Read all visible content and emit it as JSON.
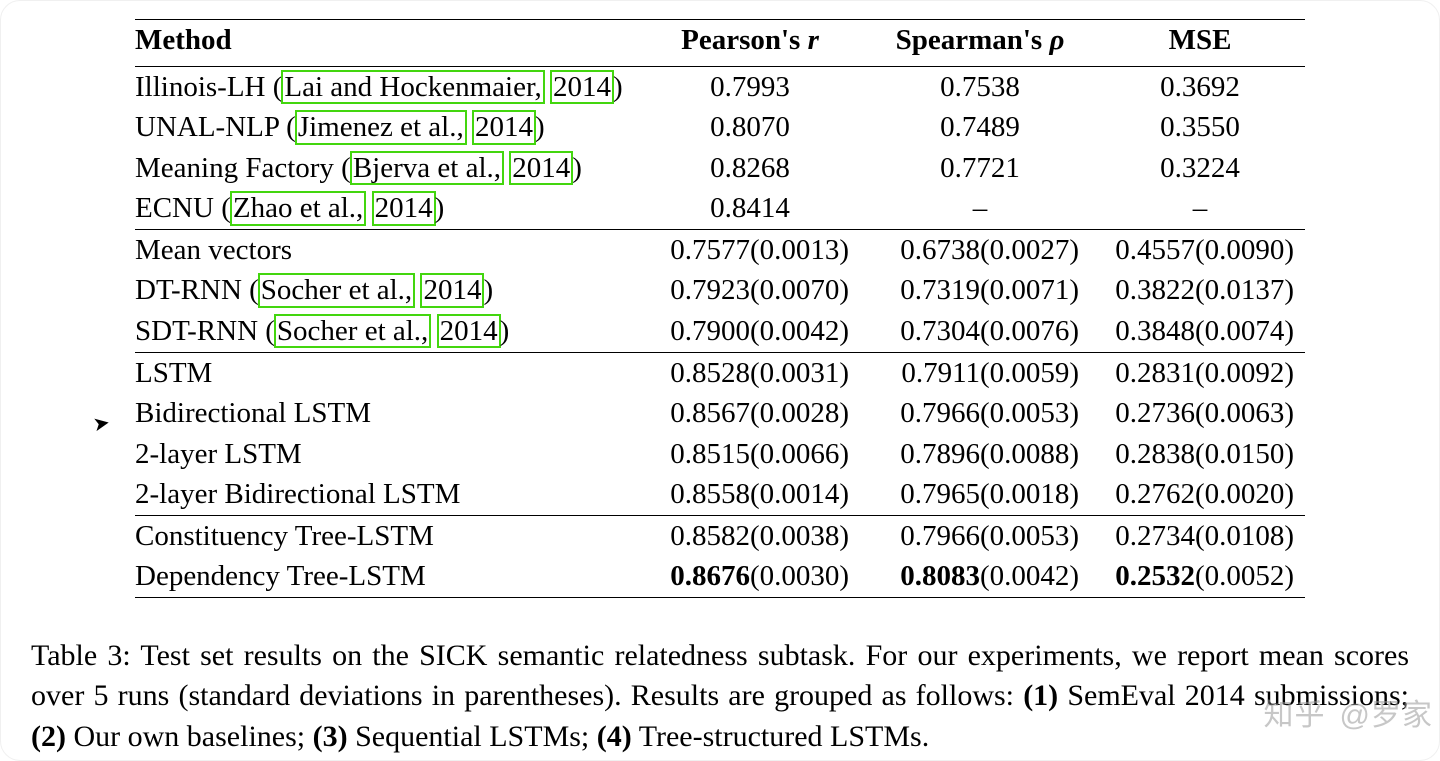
{
  "chart_data": {
    "type": "table",
    "title": "Table 3: Test set results on the SICK semantic relatedness subtask",
    "columns": [
      "Method",
      "Pearson's r",
      "Pearson's r (std)",
      "Spearman's ρ",
      "Spearman's ρ (std)",
      "MSE",
      "MSE (std)"
    ],
    "groups": [
      {
        "name": "SemEval 2014 submissions",
        "rows": [
          {
            "method": "Illinois-LH (Lai and Hockenmaier, 2014)",
            "pearson": 0.7993,
            "spearman": 0.7538,
            "mse": 0.3692
          },
          {
            "method": "UNAL-NLP (Jimenez et al., 2014)",
            "pearson": 0.807,
            "spearman": 0.7489,
            "mse": 0.355
          },
          {
            "method": "Meaning Factory (Bjerva et al., 2014)",
            "pearson": 0.8268,
            "spearman": 0.7721,
            "mse": 0.3224
          },
          {
            "method": "ECNU (Zhao et al., 2014)",
            "pearson": 0.8414,
            "spearman": null,
            "mse": null
          }
        ]
      },
      {
        "name": "Our own baselines",
        "rows": [
          {
            "method": "Mean vectors",
            "pearson": 0.7577,
            "pearson_std": 0.0013,
            "spearman": 0.6738,
            "spearman_std": 0.0027,
            "mse": 0.4557,
            "mse_std": 0.009
          },
          {
            "method": "DT-RNN (Socher et al., 2014)",
            "pearson": 0.7923,
            "pearson_std": 0.007,
            "spearman": 0.7319,
            "spearman_std": 0.0071,
            "mse": 0.3822,
            "mse_std": 0.0137
          },
          {
            "method": "SDT-RNN (Socher et al., 2014)",
            "pearson": 0.79,
            "pearson_std": 0.0042,
            "spearman": 0.7304,
            "spearman_std": 0.0076,
            "mse": 0.3848,
            "mse_std": 0.0074
          }
        ]
      },
      {
        "name": "Sequential LSTMs",
        "rows": [
          {
            "method": "LSTM",
            "pearson": 0.8528,
            "pearson_std": 0.0031,
            "spearman": 0.7911,
            "spearman_std": 0.0059,
            "mse": 0.2831,
            "mse_std": 0.0092
          },
          {
            "method": "Bidirectional LSTM",
            "pearson": 0.8567,
            "pearson_std": 0.0028,
            "spearman": 0.7966,
            "spearman_std": 0.0053,
            "mse": 0.2736,
            "mse_std": 0.0063
          },
          {
            "method": "2-layer LSTM",
            "pearson": 0.8515,
            "pearson_std": 0.0066,
            "spearman": 0.7896,
            "spearman_std": 0.0088,
            "mse": 0.2838,
            "mse_std": 0.015
          },
          {
            "method": "2-layer Bidirectional LSTM",
            "pearson": 0.8558,
            "pearson_std": 0.0014,
            "spearman": 0.7965,
            "spearman_std": 0.0018,
            "mse": 0.2762,
            "mse_std": 0.002
          }
        ]
      },
      {
        "name": "Tree-structured LSTMs",
        "rows": [
          {
            "method": "Constituency Tree-LSTM",
            "pearson": 0.8582,
            "pearson_std": 0.0038,
            "spearman": 0.7966,
            "spearman_std": 0.0053,
            "mse": 0.2734,
            "mse_std": 0.0108
          },
          {
            "method": "Dependency Tree-LSTM",
            "pearson": 0.8676,
            "pearson_std": 0.003,
            "spearman": 0.8083,
            "spearman_std": 0.0042,
            "mse": 0.2532,
            "mse_std": 0.0052,
            "bold": true
          }
        ]
      }
    ]
  },
  "header": {
    "method": "Method",
    "pearson_pre": "Pearson's ",
    "pearson_it": "r",
    "spearman_pre": "Spearman's ",
    "spearman_it": "ρ",
    "mse": "MSE"
  },
  "g1": {
    "r1": {
      "pre": "Illinois-LH (",
      "cite1": "Lai and Hockenmaier,",
      "cite2": "2014",
      "suf": ")",
      "p": "0.7993",
      "s": "0.7538",
      "m": "0.3692"
    },
    "r2": {
      "pre": "UNAL-NLP (",
      "cite1": "Jimenez et al.,",
      "cite2": "2014",
      "suf": ")",
      "p": "0.8070",
      "s": "0.7489",
      "m": "0.3550"
    },
    "r3": {
      "pre": "Meaning Factory (",
      "cite1": "Bjerva et al.,",
      "cite2": "2014",
      "suf": ")",
      "p": "0.8268",
      "s": "0.7721",
      "m": "0.3224"
    },
    "r4": {
      "pre": "ECNU (",
      "cite1": "Zhao et al.,",
      "cite2": "2014",
      "suf": ")",
      "p": "0.8414",
      "s": "–",
      "m": "–"
    }
  },
  "g2": {
    "r1": {
      "name": "Mean vectors",
      "p": "0.7577",
      "pp": "(0.0013)",
      "s": "0.6738",
      "sp": "(0.0027)",
      "m": "0.4557",
      "mp": "(0.0090)"
    },
    "r2": {
      "pre": "DT-RNN (",
      "cite1": "Socher et al.,",
      "cite2": "2014",
      "suf": ")",
      "p": "0.7923",
      "pp": "(0.0070)",
      "s": "0.7319",
      "sp": "(0.0071)",
      "m": "0.3822",
      "mp": "(0.0137)"
    },
    "r3": {
      "pre": "SDT-RNN (",
      "cite1": "Socher et al.,",
      "cite2": "2014",
      "suf": ")",
      "p": "0.7900",
      "pp": "(0.0042)",
      "s": "0.7304",
      "sp": "(0.0076)",
      "m": "0.3848",
      "mp": "(0.0074)"
    }
  },
  "g3": {
    "r1": {
      "name": "LSTM",
      "p": "0.8528",
      "pp": "(0.0031)",
      "s": "0.7911",
      "sp": "(0.0059)",
      "m": "0.2831",
      "mp": "(0.0092)"
    },
    "r2": {
      "name": "Bidirectional LSTM",
      "p": "0.8567",
      "pp": "(0.0028)",
      "s": "0.7966",
      "sp": "(0.0053)",
      "m": "0.2736",
      "mp": "(0.0063)"
    },
    "r3": {
      "name": "2-layer LSTM",
      "p": "0.8515",
      "pp": "(0.0066)",
      "s": "0.7896",
      "sp": "(0.0088)",
      "m": "0.2838",
      "mp": "(0.0150)"
    },
    "r4": {
      "name": "2-layer Bidirectional LSTM",
      "p": "0.8558",
      "pp": "(0.0014)",
      "s": "0.7965",
      "sp": "(0.0018)",
      "m": "0.2762",
      "mp": "(0.0020)"
    }
  },
  "g4": {
    "r1": {
      "name": "Constituency Tree-LSTM",
      "p": "0.8582",
      "pp": "(0.0038)",
      "s": "0.7966",
      "sp": "(0.0053)",
      "m": "0.2734",
      "mp": "(0.0108)"
    },
    "r2": {
      "name": "Dependency Tree-LSTM",
      "p": "0.8676",
      "pp": "(0.0030)",
      "s": "0.8083",
      "sp": "(0.0042)",
      "m": "0.2532",
      "mp": "(0.0052)"
    }
  },
  "caption": {
    "t1": "Table 3: Test set results on the SICK semantic relatedness subtask. For our experiments, we report mean scores over 5 runs (standard deviations in parentheses). Results are grouped as follows: ",
    "b1": "(1)",
    "s1": " SemEval 2014 submissions; ",
    "b2": "(2)",
    "s2": " Our own baselines; ",
    "b3": "(3)",
    "s3": " Sequential LSTMs; ",
    "b4": "(4)",
    "s4": " Tree-structured LSTMs."
  },
  "watermark": {
    "a": "知乎",
    "b": "@罗家"
  }
}
